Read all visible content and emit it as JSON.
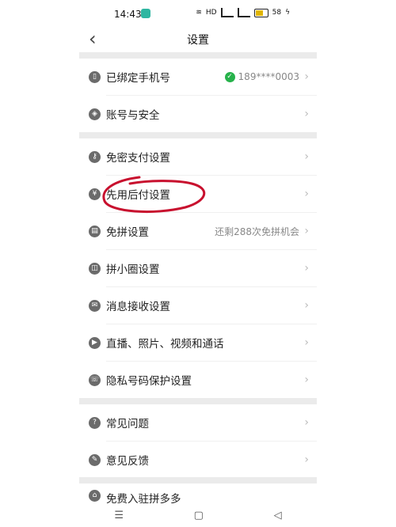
{
  "status": {
    "time": "14:43",
    "hd": "HD",
    "battery": "58"
  },
  "header": {
    "title": "设置",
    "back": "‹"
  },
  "rows": [
    {
      "label": "已绑定手机号",
      "value": "189****0003",
      "icon": "phone-icon"
    },
    {
      "label": "账号与安全",
      "value": "",
      "icon": "shield-icon"
    },
    {
      "label": "免密支付设置",
      "value": "",
      "icon": "key-icon"
    },
    {
      "label": "先用后付设置",
      "value": "",
      "icon": "payment-icon"
    },
    {
      "label": "免拼设置",
      "value": "还剩288次免拼机会",
      "icon": "document-icon"
    },
    {
      "label": "拼小圈设置",
      "value": "",
      "icon": "bag-icon"
    },
    {
      "label": "消息接收设置",
      "value": "",
      "icon": "mail-icon"
    },
    {
      "label": "直播、照片、视频和通话",
      "value": "",
      "icon": "camera-icon"
    },
    {
      "label": "隐私号码保护设置",
      "value": "",
      "icon": "phone-call-icon"
    },
    {
      "label": "常见问题",
      "value": "",
      "icon": "question-icon"
    },
    {
      "label": "意见反馈",
      "value": "",
      "icon": "edit-icon"
    },
    {
      "label": "免费入驻拼多多",
      "value": "",
      "icon": "store-icon"
    }
  ],
  "colors": {
    "annotation": "#c8102e",
    "separator": "#ebebeb",
    "verified": "#27b24b"
  },
  "bottom_nav": {
    "menu": "☰",
    "home": "▢",
    "back": "◁"
  }
}
